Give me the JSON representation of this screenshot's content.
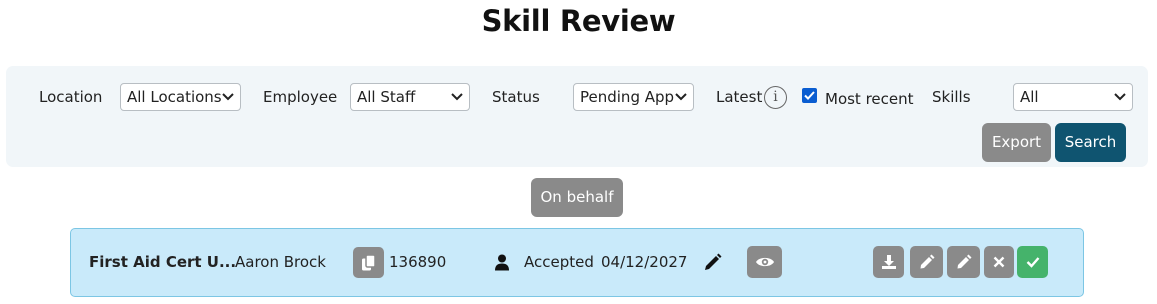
{
  "page": {
    "title": "Skill Review"
  },
  "filters": {
    "location": {
      "label": "Location",
      "selected": "All Locations"
    },
    "employee": {
      "label": "Employee",
      "selected": "All Staff"
    },
    "status": {
      "label": "Status",
      "selected": "Pending App"
    },
    "latest": {
      "label": "Latest",
      "info_icon": "info-icon",
      "checkbox_checked": true,
      "checkbox_label": "Most recent"
    },
    "skills": {
      "label": "Skills",
      "selected": "All"
    }
  },
  "actions": {
    "export_label": "Export",
    "search_label": "Search",
    "on_behalf_label": "On behalf"
  },
  "record": {
    "skill_name": "First Aid Cert U...",
    "employee_name": "Aaron Brock",
    "id_number": "136890",
    "status": "Accepted",
    "date": "04/12/2027",
    "icons": [
      "copy-icon",
      "person-icon",
      "pencil-icon",
      "eye-icon",
      "download-icon",
      "edit-icon",
      "edit-alt-icon",
      "close-icon",
      "check-icon"
    ]
  },
  "colors": {
    "panel_bg": "#f1f6f9",
    "search_button": "#0f5470",
    "grey_button": "#8a8a8a",
    "record_bg": "#c9eafa",
    "approve_button": "#45b36b",
    "checkbox": "#0a5dd1"
  }
}
